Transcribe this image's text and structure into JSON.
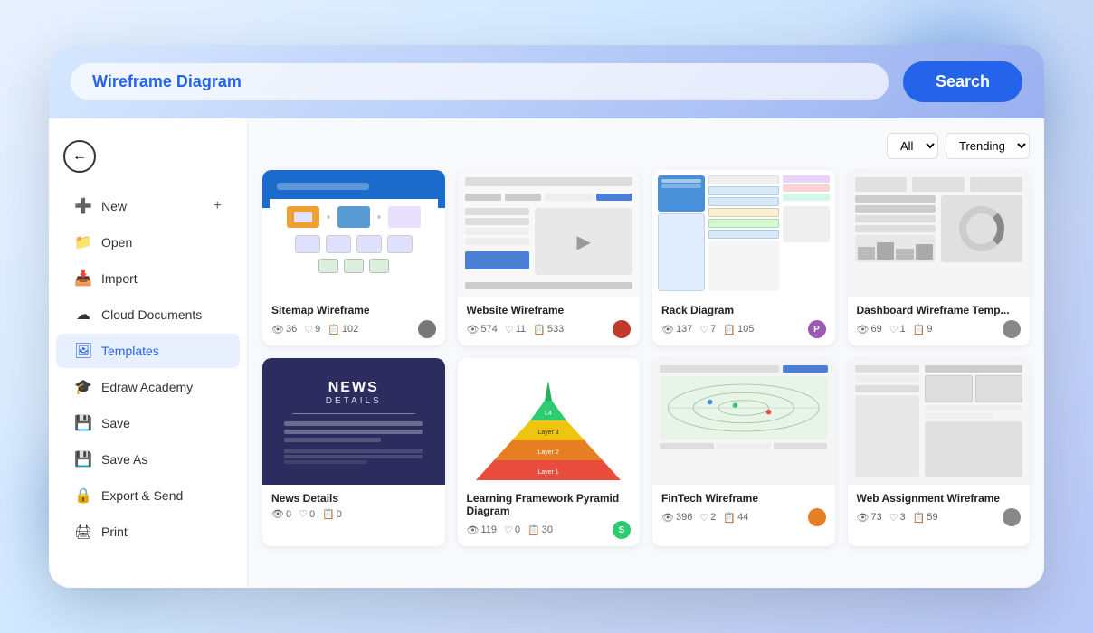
{
  "topBar": {
    "searchValue": "Wireframe Diagram",
    "searchPlaceholder": "Wireframe Diagram",
    "searchButtonLabel": "Search"
  },
  "sidebar": {
    "backButton": "←",
    "items": [
      {
        "id": "new",
        "label": "New",
        "icon": "➕",
        "hasPlus": true
      },
      {
        "id": "open",
        "label": "Open",
        "icon": "📁",
        "hasPlus": false
      },
      {
        "id": "import",
        "label": "Import",
        "icon": "📥",
        "hasPlus": false
      },
      {
        "id": "cloud",
        "label": "Cloud Documents",
        "icon": "☁",
        "hasPlus": false
      },
      {
        "id": "templates",
        "label": "Templates",
        "icon": "🖼",
        "hasPlus": false,
        "active": true
      },
      {
        "id": "academy",
        "label": "Edraw Academy",
        "icon": "🎓",
        "hasPlus": false
      },
      {
        "id": "save",
        "label": "Save",
        "icon": "💾",
        "hasPlus": false
      },
      {
        "id": "saveas",
        "label": "Save As",
        "icon": "💾",
        "hasPlus": false
      },
      {
        "id": "export",
        "label": "Export & Send",
        "icon": "🔒",
        "hasPlus": false
      },
      {
        "id": "print",
        "label": "Print",
        "icon": "🖨",
        "hasPlus": false
      }
    ]
  },
  "filters": {
    "categoryOptions": [
      "All"
    ],
    "sortOptions": [
      "Trending"
    ],
    "categoryLabel": "All",
    "sortLabel": "Trending"
  },
  "templates": [
    {
      "id": "sitemap-wireframe",
      "name": "Sitemap Wireframe",
      "type": "sitemap",
      "views": 36,
      "likes": 9,
      "copies": 102,
      "avatarColor": "#555",
      "avatarText": ""
    },
    {
      "id": "website-wireframe",
      "name": "Website Wireframe",
      "type": "website",
      "views": 574,
      "likes": 11,
      "copies": 533,
      "avatarColor": "#c0392b",
      "avatarText": ""
    },
    {
      "id": "rack-diagram",
      "name": "Rack Diagram",
      "type": "rack",
      "views": 137,
      "likes": 7,
      "copies": 105,
      "avatarColor": "#9b59b6",
      "avatarText": "P"
    },
    {
      "id": "dashboard-wireframe",
      "name": "Dashboard Wireframe Temp...",
      "type": "dashboard",
      "views": 69,
      "likes": 1,
      "copies": 9,
      "avatarColor": "#666",
      "avatarText": ""
    },
    {
      "id": "news-template",
      "name": "News Details",
      "type": "news",
      "views": 0,
      "likes": 0,
      "copies": 0,
      "avatarColor": "#666",
      "avatarText": ""
    },
    {
      "id": "learning-pyramid",
      "name": "Learning Framework Pyramid Diagram",
      "type": "pyramid",
      "views": 119,
      "likes": 0,
      "copies": 30,
      "avatarColor": "#2ecc71",
      "avatarText": "S"
    },
    {
      "id": "fintech-wireframe",
      "name": "FinTech Wireframe",
      "type": "fintech",
      "views": 396,
      "likes": 2,
      "copies": 44,
      "avatarColor": "#e67e22",
      "avatarText": ""
    },
    {
      "id": "web-assignment",
      "name": "Web Assignment Wireframe",
      "type": "webassign",
      "views": 73,
      "likes": 3,
      "copies": 59,
      "avatarColor": "#666",
      "avatarText": ""
    }
  ]
}
